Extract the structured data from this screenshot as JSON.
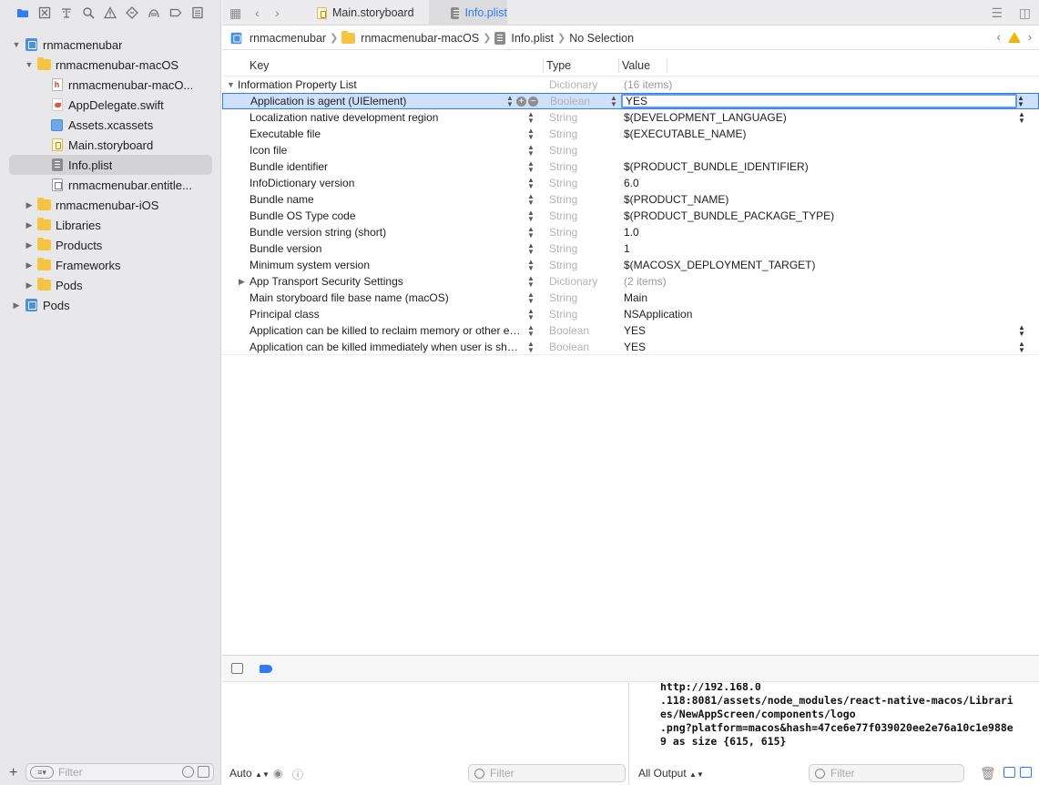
{
  "navigator_toolbar": {
    "icons": [
      "folder-icon",
      "source-control-icon",
      "symbol-icon",
      "find-icon",
      "issue-icon",
      "test-icon",
      "debug-icon",
      "breakpoint-icon",
      "report-icon"
    ]
  },
  "tree": [
    {
      "label": "rnmacmenubar",
      "icon": "project-icon",
      "expanded": true,
      "level": 0
    },
    {
      "label": "rnmacmenubar-macOS",
      "icon": "folder-icon",
      "expanded": true,
      "level": 1
    },
    {
      "label": "rnmacmenubar-macO...",
      "icon": "header-file-icon",
      "level": 2
    },
    {
      "label": "AppDelegate.swift",
      "icon": "swift-file-icon",
      "level": 2
    },
    {
      "label": "Assets.xcassets",
      "icon": "assets-icon",
      "level": 2
    },
    {
      "label": "Main.storyboard",
      "icon": "storyboard-icon",
      "level": 2
    },
    {
      "label": "Info.plist",
      "icon": "plist-icon",
      "level": 2,
      "selected": true
    },
    {
      "label": "rnmacmenubar.entitle...",
      "icon": "entitlements-icon",
      "level": 2
    },
    {
      "label": "rnmacmenubar-iOS",
      "icon": "folder-icon",
      "expanded": false,
      "level": 1
    },
    {
      "label": "Libraries",
      "icon": "folder-icon",
      "expanded": false,
      "level": 1
    },
    {
      "label": "Products",
      "icon": "folder-icon",
      "expanded": false,
      "level": 1
    },
    {
      "label": "Frameworks",
      "icon": "folder-icon",
      "expanded": false,
      "level": 1
    },
    {
      "label": "Pods",
      "icon": "folder-icon",
      "expanded": false,
      "level": 1
    },
    {
      "label": "Pods",
      "icon": "project-icon",
      "expanded": false,
      "level": 0
    }
  ],
  "sidebar_filter": {
    "placeholder": "Filter"
  },
  "tabs": [
    {
      "label": "Main.storyboard",
      "active": false
    },
    {
      "label": "Info.plist",
      "active": true
    }
  ],
  "jumpbar": {
    "crumbs": [
      "rnmacmenubar",
      "rnmacmenubar-macOS",
      "Info.plist",
      "No Selection"
    ]
  },
  "plist": {
    "headers": {
      "key": "Key",
      "type": "Type",
      "value": "Value"
    },
    "root": {
      "key": "Information Property List",
      "type": "Dictionary",
      "value": "(16 items)"
    },
    "rows": [
      {
        "key": "Application is agent (UIElement)",
        "type": "Boolean",
        "value": "YES",
        "selected": true,
        "popup": true
      },
      {
        "key": "Localization native development region",
        "type": "String",
        "value": "$(DEVELOPMENT_LANGUAGE)",
        "popup": true
      },
      {
        "key": "Executable file",
        "type": "String",
        "value": "$(EXECUTABLE_NAME)"
      },
      {
        "key": "Icon file",
        "type": "String",
        "value": ""
      },
      {
        "key": "Bundle identifier",
        "type": "String",
        "value": "$(PRODUCT_BUNDLE_IDENTIFIER)"
      },
      {
        "key": "InfoDictionary version",
        "type": "String",
        "value": "6.0"
      },
      {
        "key": "Bundle name",
        "type": "String",
        "value": "$(PRODUCT_NAME)"
      },
      {
        "key": "Bundle OS Type code",
        "type": "String",
        "value": "$(PRODUCT_BUNDLE_PACKAGE_TYPE)"
      },
      {
        "key": "Bundle version string (short)",
        "type": "String",
        "value": "1.0"
      },
      {
        "key": "Bundle version",
        "type": "String",
        "value": "1"
      },
      {
        "key": "Minimum system version",
        "type": "String",
        "value": "$(MACOSX_DEPLOYMENT_TARGET)"
      },
      {
        "key": "App Transport Security Settings",
        "type": "Dictionary",
        "value": "(2 items)",
        "expandable": true
      },
      {
        "key": "Main storyboard file base name (macOS)",
        "type": "String",
        "value": "Main"
      },
      {
        "key": "Principal class",
        "type": "String",
        "value": "NSApplication"
      },
      {
        "key": "Application can be killed to reclaim memory or other ex...",
        "type": "Boolean",
        "value": "YES",
        "popup": true
      },
      {
        "key": "Application can be killed immediately when user is shut...",
        "type": "Boolean",
        "value": "YES",
        "popup": true
      }
    ]
  },
  "console": {
    "lines": [
      "http://192.168.0",
      ".118:8081/assets/node_modules/react-native-macos/Librari",
      "es/NewAppScreen/components/logo",
      ".png?platform=macos&hash=47ce6e77f039020ee2e76a10c1e988e",
      "9 as size {615, 615}"
    ]
  },
  "debug_footer": {
    "auto_label": "Auto",
    "vars_filter_placeholder": "Filter",
    "output_label": "All Output",
    "console_filter_placeholder": "Filter"
  },
  "colors": {
    "accent": "#2f7cf6",
    "selection": "#cfe0fb",
    "sidebar_bg": "#e8e8ea",
    "warning": "#f2b400"
  }
}
